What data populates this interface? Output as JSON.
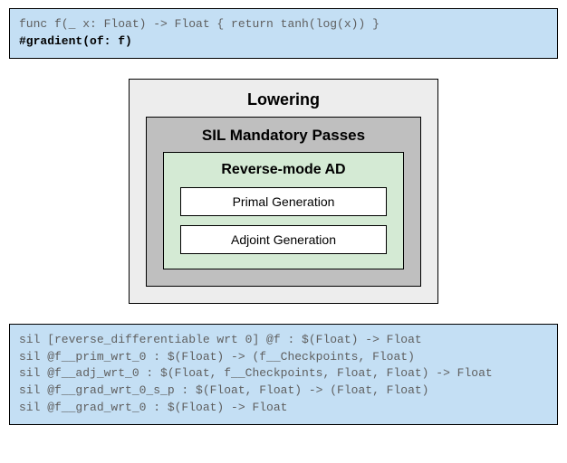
{
  "top_code": {
    "line1": "func f(_ x: Float) -> Float { return tanh(log(x)) }",
    "line2": "#gradient(of: f)"
  },
  "diagram": {
    "lowering": "Lowering",
    "sil_passes": "SIL Mandatory Passes",
    "reverse_ad": "Reverse-mode AD",
    "primal": "Primal Generation",
    "adjoint": "Adjoint Generation"
  },
  "bottom_code": {
    "line1": "sil [reverse_differentiable wrt 0] @f : $(Float) -> Float",
    "line2": "sil @f__prim_wrt_0 : $(Float) -> (f__Checkpoints, Float)",
    "line3": "sil @f__adj_wrt_0 : $(Float, f__Checkpoints, Float, Float) -> Float",
    "line4": "sil @f__grad_wrt_0_s_p : $(Float, Float) -> (Float, Float)",
    "line5": "sil @f__grad_wrt_0 : $(Float) -> Float"
  }
}
